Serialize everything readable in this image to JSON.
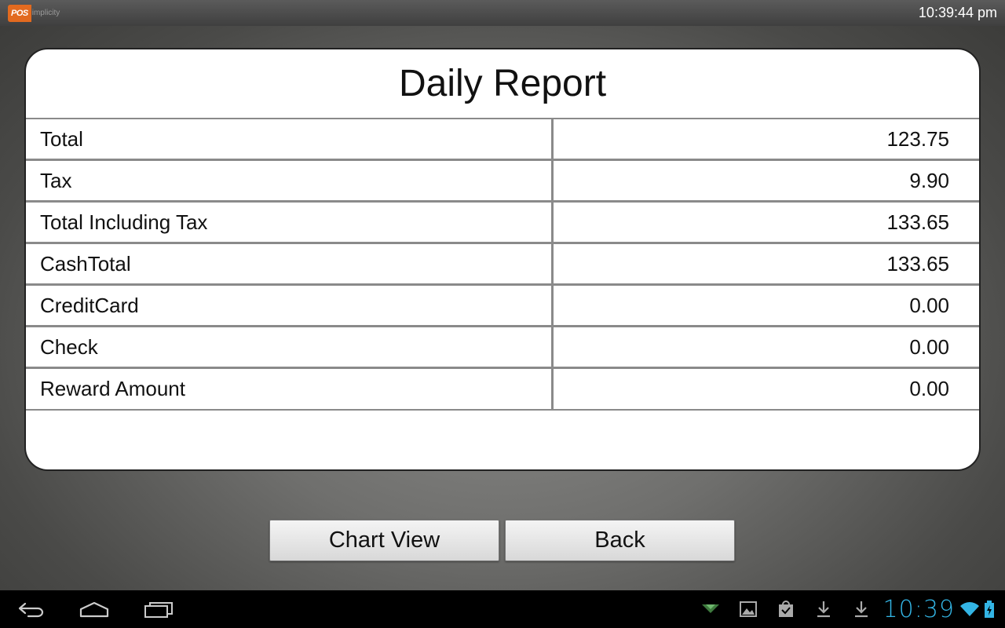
{
  "app": {
    "logo_pos": "POS",
    "logo_rest": "implicity",
    "time": "10:39:44 pm"
  },
  "report": {
    "title": "Daily Report",
    "rows": [
      {
        "label": "Total",
        "value": "123.75"
      },
      {
        "label": "Tax",
        "value": "9.90"
      },
      {
        "label": "Total Including Tax",
        "value": "133.65"
      },
      {
        "label": "CashTotal",
        "value": "133.65"
      },
      {
        "label": "CreditCard",
        "value": "0.00"
      },
      {
        "label": "Check",
        "value": "0.00"
      },
      {
        "label": "Reward Amount",
        "value": "0.00"
      }
    ]
  },
  "buttons": {
    "chart_view": "Chart View",
    "back": "Back"
  },
  "system_bar": {
    "clock": "10:39",
    "accent_color": "#33b5e5",
    "icons": [
      "back-icon",
      "home-icon",
      "recent-apps-icon",
      "signal-notification-icon",
      "gallery-icon",
      "shopping-bag-icon",
      "download-icon",
      "download-icon",
      "wifi-icon",
      "battery-charging-icon"
    ]
  }
}
